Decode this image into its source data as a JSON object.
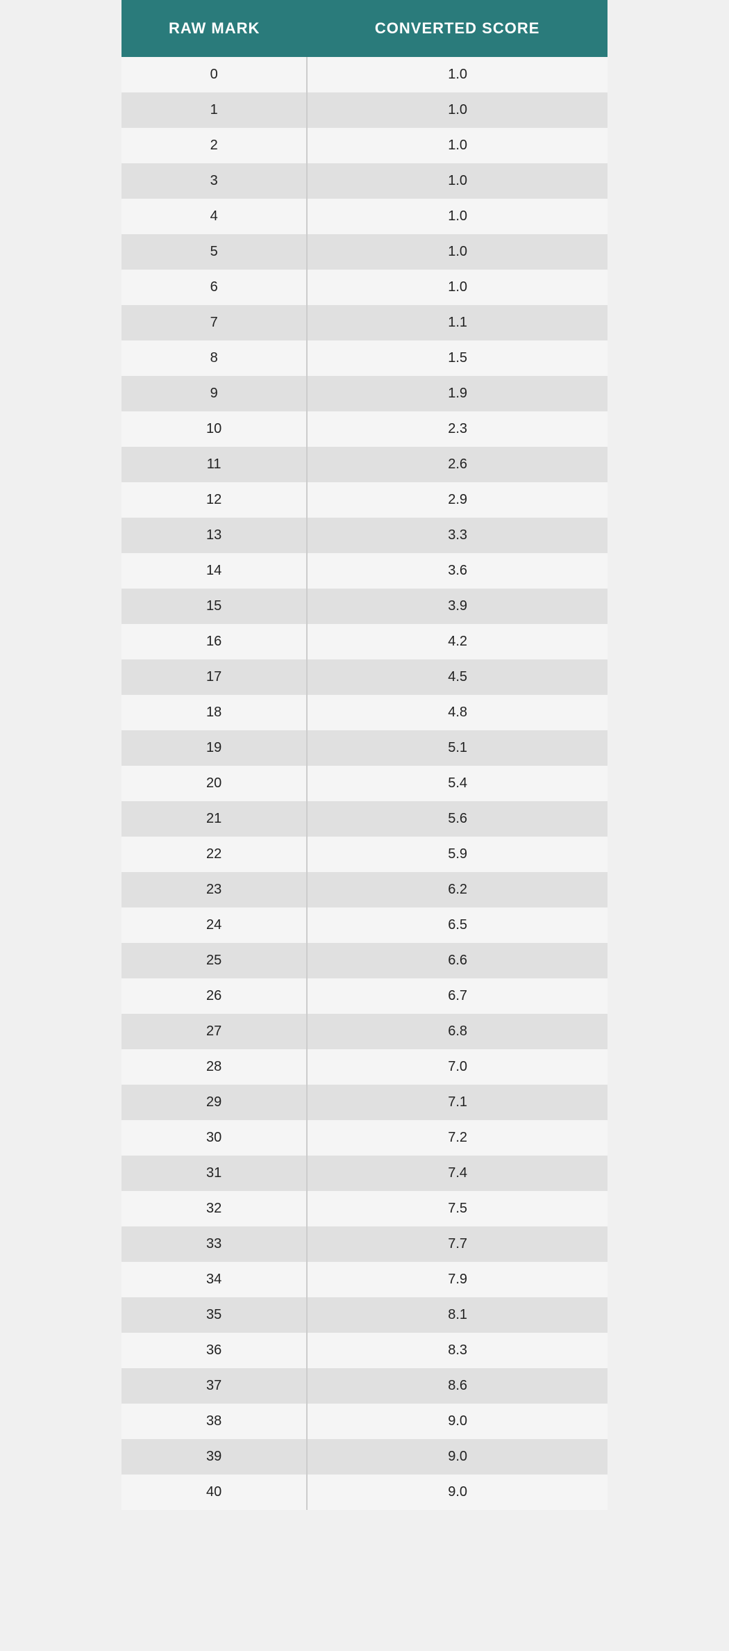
{
  "header": {
    "col1": "RAW MARK",
    "col2": "CONVERTED SCORE"
  },
  "rows": [
    {
      "raw": "0",
      "converted": "1.0"
    },
    {
      "raw": "1",
      "converted": "1.0"
    },
    {
      "raw": "2",
      "converted": "1.0"
    },
    {
      "raw": "3",
      "converted": "1.0"
    },
    {
      "raw": "4",
      "converted": "1.0"
    },
    {
      "raw": "5",
      "converted": "1.0"
    },
    {
      "raw": "6",
      "converted": "1.0"
    },
    {
      "raw": "7",
      "converted": "1.1"
    },
    {
      "raw": "8",
      "converted": "1.5"
    },
    {
      "raw": "9",
      "converted": "1.9"
    },
    {
      "raw": "10",
      "converted": "2.3"
    },
    {
      "raw": "11",
      "converted": "2.6"
    },
    {
      "raw": "12",
      "converted": "2.9"
    },
    {
      "raw": "13",
      "converted": "3.3"
    },
    {
      "raw": "14",
      "converted": "3.6"
    },
    {
      "raw": "15",
      "converted": "3.9"
    },
    {
      "raw": "16",
      "converted": "4.2"
    },
    {
      "raw": "17",
      "converted": "4.5"
    },
    {
      "raw": "18",
      "converted": "4.8"
    },
    {
      "raw": "19",
      "converted": "5.1"
    },
    {
      "raw": "20",
      "converted": "5.4"
    },
    {
      "raw": "21",
      "converted": "5.6"
    },
    {
      "raw": "22",
      "converted": "5.9"
    },
    {
      "raw": "23",
      "converted": "6.2"
    },
    {
      "raw": "24",
      "converted": "6.5"
    },
    {
      "raw": "25",
      "converted": "6.6"
    },
    {
      "raw": "26",
      "converted": "6.7"
    },
    {
      "raw": "27",
      "converted": "6.8"
    },
    {
      "raw": "28",
      "converted": "7.0"
    },
    {
      "raw": "29",
      "converted": "7.1"
    },
    {
      "raw": "30",
      "converted": "7.2"
    },
    {
      "raw": "31",
      "converted": "7.4"
    },
    {
      "raw": "32",
      "converted": "7.5"
    },
    {
      "raw": "33",
      "converted": "7.7"
    },
    {
      "raw": "34",
      "converted": "7.9"
    },
    {
      "raw": "35",
      "converted": "8.1"
    },
    {
      "raw": "36",
      "converted": "8.3"
    },
    {
      "raw": "37",
      "converted": "8.6"
    },
    {
      "raw": "38",
      "converted": "9.0"
    },
    {
      "raw": "39",
      "converted": "9.0"
    },
    {
      "raw": "40",
      "converted": "9.0"
    }
  ]
}
